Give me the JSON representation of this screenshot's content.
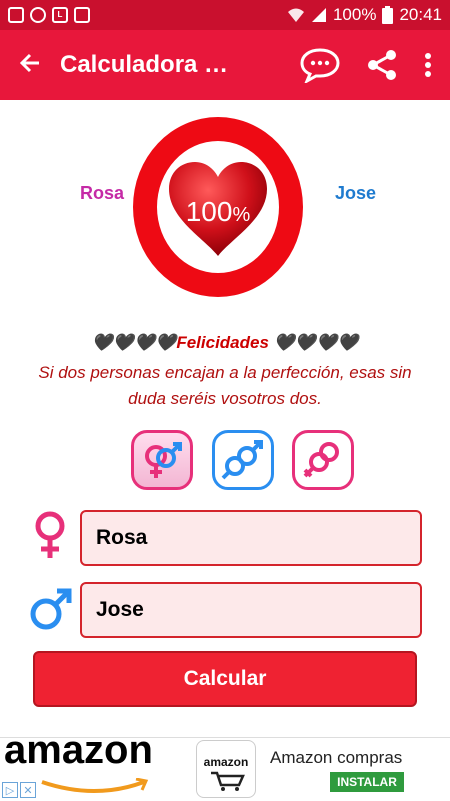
{
  "status_bar": {
    "battery": "100%",
    "time": "20:41",
    "left_icons": [
      "image-icon",
      "emoji-icon",
      "line-app-icon",
      "inbox-icon"
    ]
  },
  "app_bar": {
    "title": "Calculadora n…",
    "icons": [
      "back-arrow-icon",
      "chat-bubble-icon",
      "share-icon",
      "more-vert-icon"
    ]
  },
  "result": {
    "name_left": "Rosa",
    "name_right": "Jose",
    "percent": "100",
    "percent_sign": "%",
    "hearts_left": "🖤🖤🖤🖤",
    "headline": "Felicidades",
    "hearts_right": "🖤🖤🖤🖤",
    "message_line1": "Si dos personas encajan a la perfección, esas sin",
    "message_line2": "duda seréis vosotros dos."
  },
  "gender_buttons": [
    {
      "name": "female-male-button",
      "border": "#e7307a"
    },
    {
      "name": "male-male-button",
      "border": "#2a8ef0"
    },
    {
      "name": "female-female-button",
      "border": "#e7307a"
    }
  ],
  "form": {
    "female_value": "Rosa",
    "male_value": "Jose",
    "calculate_label": "Calcular"
  },
  "ad": {
    "banner_word": "amazon",
    "logo_text": "amazon",
    "title": "Amazon compras",
    "install_label": "INSTALAR"
  },
  "colors": {
    "primary": "#e8173b",
    "status_bar": "#c9102e",
    "heart": "#d0101a",
    "ring": "#ee0a14",
    "female": "#e7307a",
    "male": "#2a8ef0"
  }
}
